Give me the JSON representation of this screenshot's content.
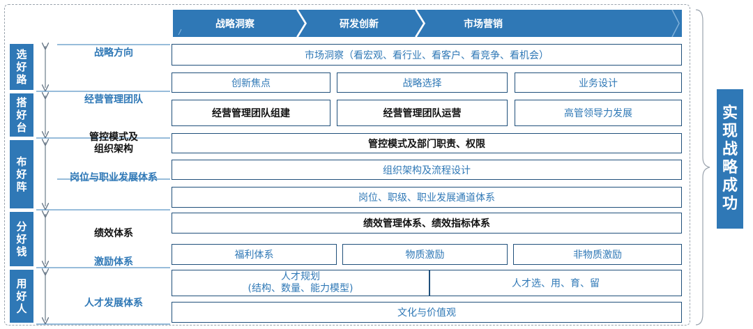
{
  "header": {
    "tabs": [
      "战略洞察",
      "研发创新",
      "市场营销"
    ],
    "color": "#2f78b6"
  },
  "sidebar": {
    "stages": [
      "选好路",
      "搭好台",
      "布好阵",
      "分好钱",
      "用好人"
    ]
  },
  "categories": {
    "strategy": "战略方向",
    "team": "经营管理团队",
    "control": "管控模式及\n组织架构",
    "career": "岗位与职业发展体系",
    "performance": "绩效体系",
    "incentive": "激励体系",
    "talent": "人才发展体系"
  },
  "rows": {
    "market_insight": "市场洞察（看宏观、看行业、看客户、看竞争、看机会）",
    "innovation": "创新焦点",
    "strategy_choice": "战略选择",
    "business_design": "业务设计",
    "team_build": "经营管理团队组建",
    "team_operate": "经营管理团队运营",
    "leadership": "高管领导力发展",
    "control_mode": "管控模式及部门职责、权限",
    "org_process": "组织架构及流程设计",
    "career_channel": "岗位、职级、职业发展通道体系",
    "performance_system": "绩效管理体系、绩效指标体系",
    "welfare": "福利体系",
    "material_incentive": "物质激励",
    "nonmaterial_incentive": "非物质激励",
    "talent_plan": "人才规划\n(结构、数量、能力模型)",
    "talent_use": "人才选、用、育、留",
    "culture": "文化与价值观"
  },
  "result": "实现战略成功"
}
